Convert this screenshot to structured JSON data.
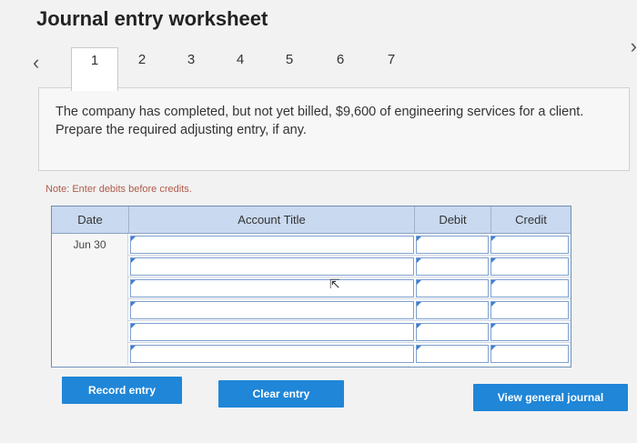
{
  "header": {
    "title": "Journal entry worksheet"
  },
  "nav": {
    "prev_icon": "chevron-left-icon",
    "next_icon": "chevron-right-icon",
    "tabs": [
      {
        "label": "1",
        "active": true
      },
      {
        "label": "2"
      },
      {
        "label": "3"
      },
      {
        "label": "4"
      },
      {
        "label": "5"
      },
      {
        "label": "6"
      },
      {
        "label": "7"
      }
    ]
  },
  "question": {
    "text": "The company has completed, but not yet billed, $9,600 of engineering services for a client. Prepare the required adjusting entry, if any."
  },
  "note": "Note: Enter debits before credits.",
  "table": {
    "headers": {
      "date": "Date",
      "account": "Account Title",
      "debit": "Debit",
      "credit": "Credit"
    },
    "rows": [
      {
        "date": "Jun 30",
        "account": "",
        "debit": "",
        "credit": ""
      },
      {
        "date": "",
        "account": "",
        "debit": "",
        "credit": ""
      },
      {
        "date": "",
        "account": "",
        "debit": "",
        "credit": ""
      },
      {
        "date": "",
        "account": "",
        "debit": "",
        "credit": ""
      },
      {
        "date": "",
        "account": "",
        "debit": "",
        "credit": ""
      },
      {
        "date": "",
        "account": "",
        "debit": "",
        "credit": ""
      }
    ]
  },
  "buttons": {
    "record": "Record entry",
    "clear": "Clear entry",
    "view": "View general journal"
  },
  "colors": {
    "accent": "#1f86d8",
    "header_bg": "#c9d9ef",
    "note": "#b05a4a"
  }
}
